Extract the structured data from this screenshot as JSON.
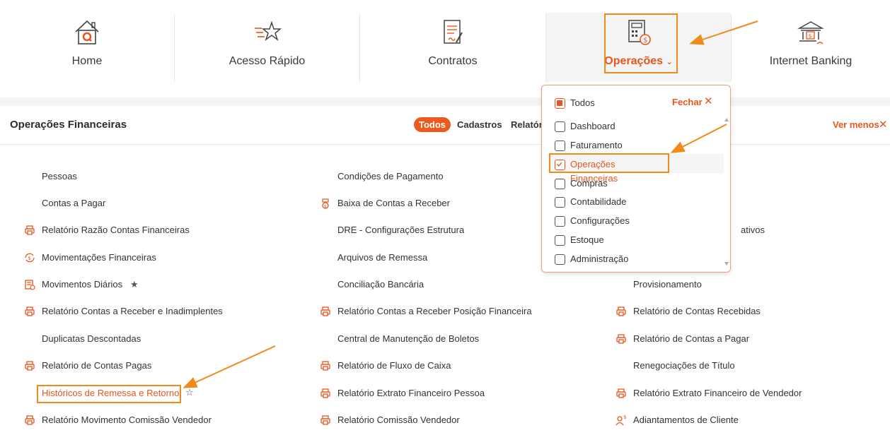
{
  "topnav": {
    "items": [
      {
        "label": "Home",
        "icon": "home-icon"
      },
      {
        "label": "Acesso Rápido",
        "icon": "star-lines-icon"
      },
      {
        "label": "Contratos",
        "icon": "contract-icon"
      },
      {
        "label": "Operações",
        "icon": "calculator-coin-icon",
        "active": true
      },
      {
        "label": "Internet Banking",
        "icon": "bank-icon"
      }
    ]
  },
  "section": {
    "title": "Operações Financeiras",
    "filters": [
      "Todos",
      "Cadastros",
      "Relatóri"
    ],
    "ver_menos": "Ver menos"
  },
  "col1": [
    {
      "label": "Pessoas",
      "icon": ""
    },
    {
      "label": "Contas a Pagar",
      "icon": ""
    },
    {
      "label": "Relatório Razão Contas Financeiras",
      "icon": "printer-icon"
    },
    {
      "label": "Movimentações Financeiras",
      "icon": "money-cycle-icon"
    },
    {
      "label": "Movimentos Diários",
      "icon": "daily-list-icon",
      "favorite": true
    },
    {
      "label": "Relatório Contas a Receber e Inadimplentes",
      "icon": "printer-icon"
    },
    {
      "label": "Duplicatas Descontadas",
      "icon": ""
    },
    {
      "label": "Relatório de Contas Pagas",
      "icon": "printer-icon"
    },
    {
      "label": "Históricos de Remessa e Retorno",
      "icon": "",
      "highlighted": true
    },
    {
      "label": "Relatório Movimento Comissão Vendedor",
      "icon": "printer-icon"
    }
  ],
  "col2": [
    {
      "label": "Condições de Pagamento",
      "icon": ""
    },
    {
      "label": "Baixa de Contas a Receber",
      "icon": "money-bag-icon"
    },
    {
      "label": "DRE - Configurações Estrutura",
      "icon": ""
    },
    {
      "label": "Arquivos de Remessa",
      "icon": ""
    },
    {
      "label": "Conciliação Bancária",
      "icon": ""
    },
    {
      "label": "Relatório Contas a Receber Posição Financeira",
      "icon": "printer-icon"
    },
    {
      "label": "Central de Manutenção de Boletos",
      "icon": ""
    },
    {
      "label": "Relatório de Fluxo de Caixa",
      "icon": "printer-icon"
    },
    {
      "label": "Relatório Extrato Financeiro Pessoa",
      "icon": "printer-icon"
    },
    {
      "label": "Relatório Comissão Vendedor",
      "icon": "printer-icon"
    }
  ],
  "col3": [
    {
      "label": "ativos",
      "icon": ""
    },
    {
      "label": "Provisionamento",
      "icon": ""
    },
    {
      "label": "Relatório de Contas Recebidas",
      "icon": "printer-icon"
    },
    {
      "label": "Relatório de Contas a Pagar",
      "icon": "printer-icon"
    },
    {
      "label": "Renegociações de Título",
      "icon": ""
    },
    {
      "label": "Relatório Extrato Financeiro de Vendedor",
      "icon": "printer-icon"
    },
    {
      "label": "Adiantamentos de Cliente",
      "icon": "person-money-icon"
    }
  ],
  "dropdown": {
    "fechar": "Fechar",
    "items": [
      {
        "label": "Todos",
        "state": "partial"
      },
      {
        "label": "Dashboard",
        "state": "unchecked"
      },
      {
        "label": "Faturamento",
        "state": "unchecked"
      },
      {
        "label": "Operações Financeiras",
        "state": "checked"
      },
      {
        "label": "Compras",
        "state": "unchecked"
      },
      {
        "label": "Contabilidade",
        "state": "unchecked"
      },
      {
        "label": "Configurações",
        "state": "unchecked"
      },
      {
        "label": "Estoque",
        "state": "unchecked"
      },
      {
        "label": "Administração",
        "state": "unchecked"
      }
    ]
  },
  "colors": {
    "accent": "#e8541d",
    "highlight": "#f08a1a"
  }
}
